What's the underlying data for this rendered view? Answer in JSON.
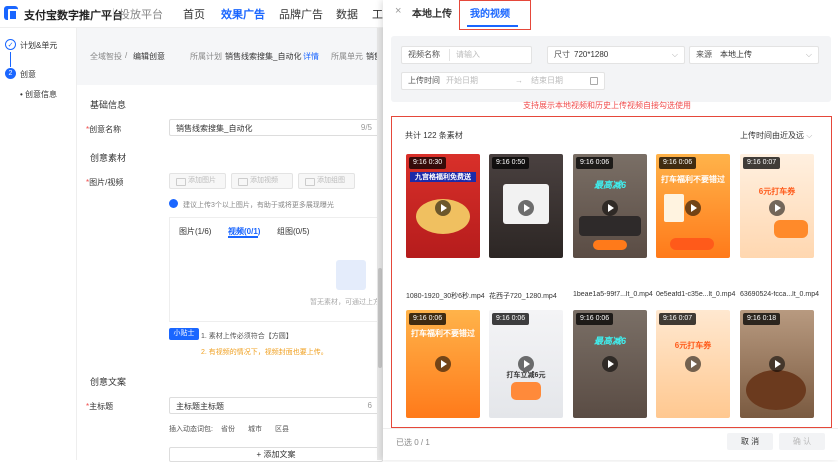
{
  "topbar": {
    "brand": "支付宝数字推广平台",
    "nav": [
      "投放平台",
      "首页",
      "效果广告",
      "品牌广告",
      "数据",
      "工"
    ]
  },
  "leftnav": {
    "steps": [
      {
        "num": "✓",
        "label": "计划&单元"
      },
      {
        "num": "2",
        "label": "创意"
      }
    ],
    "sub": "创意信息"
  },
  "main": {
    "breadcrumb": [
      "全域智投",
      "/",
      "编辑创意"
    ],
    "plan_key": "所属计划",
    "plan_val": "销售线索搜集_自动化",
    "detail": "详情",
    "unit_key": "所属单元",
    "unit_val": "销售",
    "basic_info": "基础信息",
    "creative_name_label": "创意名称",
    "creative_name_value": "销售线索搜集_自动化",
    "creative_name_count": "9/5",
    "material_section": "创意素材",
    "image_video_label": "图片/视频",
    "add_image": "添加图片",
    "add_video": "添加视频",
    "add_group": "添加组图",
    "hint": "建议上传3个以上图片，有助于或将更多展现曝光",
    "tabs": [
      "图片(1/6)",
      "视频(0/1)",
      "组图(0/5)"
    ],
    "upload_hint": "暂无素材，可通过上方按",
    "tip_tag": "小贴士",
    "tip1": "1. 素材上传必须符合【方圆】",
    "tip2": "2. 有视频的情况下，视频封面也要上传。",
    "copy_section": "创意文案",
    "main_title_label": "主标题",
    "main_title_value": "主标题主标题",
    "main_title_count": "6",
    "dynamic_label": "插入动态词包:",
    "dynamic_words": [
      "省份",
      "城市",
      "区县"
    ],
    "add_copy": "+ 添加文案"
  },
  "drawer": {
    "close": "×",
    "tab_local": "本地上传",
    "tab_mine": "我的视频",
    "filters": {
      "name_key": "视频名称",
      "name_ph": "请输入",
      "size_key": "尺寸",
      "size_val": "720*1280",
      "source_key": "来源",
      "source_val": "本地上传",
      "time_key": "上传时间",
      "start_ph": "开始日期",
      "arrow": "→",
      "end_ph": "结束日期"
    },
    "note": "支持展示本地视频和历史上传视频自接勾选使用",
    "count": "共计 122 条素材",
    "sort": "上传时间由近及远",
    "videos": [
      {
        "dur": "9:16 0:30",
        "title": "九宫格福利免费送",
        "name": "1080-1920_30秒6秒.mp4"
      },
      {
        "dur": "9:16 0:50",
        "title": "",
        "name": "花西子720_1280.mp4"
      },
      {
        "dur": "9:16 0:06",
        "title": "最高减6",
        "name": "1beae1a5-99f7...lt_0.mp4"
      },
      {
        "dur": "9:16 0:06",
        "title": "打车福利不要错过",
        "name": "0e5eafd1-c35e...lt_0.mp4"
      },
      {
        "dur": "9:16 0:07",
        "title": "6元打车券",
        "name": "63690524-fcca...lt_0.mp4"
      },
      {
        "dur": "9:16 0:06",
        "title": "打车福利不要错过",
        "name": ""
      },
      {
        "dur": "9:16 0:06",
        "title": "打车立减6元",
        "name": ""
      },
      {
        "dur": "9:16 0:06",
        "title": "最高减6",
        "name": ""
      },
      {
        "dur": "9:16 0:07",
        "title": "6元打车券",
        "name": ""
      },
      {
        "dur": "9:16 0:18",
        "title": "",
        "name": ""
      }
    ],
    "selected": "已选 0 / 1",
    "cancel": "取 消",
    "confirm": "确 认"
  },
  "colors": {
    "accent": "#1a66ff",
    "red": "#e5483a"
  }
}
